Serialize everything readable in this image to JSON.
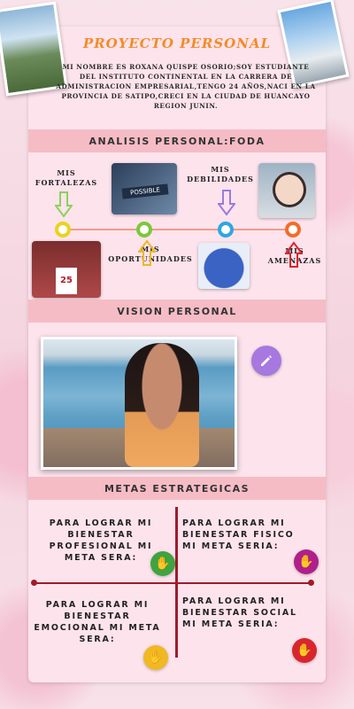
{
  "header": {
    "title": "PROYECTO PERSONAL",
    "intro": "MI NOMBRE ES ROXANA QUISPE OSORIO;SOY ESTUDIANTE DEL INSTITUTO CONTINENTAL EN LA CARRERA DE ADMINISTRACION EMPRESARIAL,TENGO 24 AÑOS,NACI EN LA PROVINCIA DE SATIPO,CRECI EN LA CIUDAD DE HUANCAYO REGION JUNIN."
  },
  "foda": {
    "heading": "ANALISIS PERSONAL:FODA",
    "fortalezas": "MIS\nFORTALEZAS",
    "debilidades": "MIS\nDEBILIDADES",
    "oportunidades": "MIS\nOPORTUNIDADES",
    "amenazas": "MIS\nAMENAZAS",
    "possible_sign": "POSSIBLE",
    "jersey_number": "25",
    "colors": {
      "fortalezas": "#e8d41f",
      "oportunidades": "#7cc83a",
      "debilidades": "#2fa7e0",
      "amenazas": "#f26d2a"
    }
  },
  "vision": {
    "heading": "VISION PERSONAL",
    "edit_icon": "pencil-icon"
  },
  "metas": {
    "heading": "METAS ESTRATEGICAS",
    "profesional": "PARA LOGRAR MI\nBIENESTAR\nPROFESIONAL   MI\nMETA SERA:",
    "fisico": "PARA LOGRAR MI\nBIENESTAR FISICO\nMI META SERIA:",
    "emocional": "PARA LOGRAR MI\nBIENESTAR\nEMOCIONAL MI META\nSERA:",
    "social": "PARA LOGRAR MI\nBIENESTAR SOCIAL\nMI META SERIA:",
    "hand_icon": "hand-icon",
    "colors": {
      "profesional": "#3fa33f",
      "fisico": "#b0208a",
      "emocional": "#f0b822",
      "social": "#d8262c"
    }
  }
}
